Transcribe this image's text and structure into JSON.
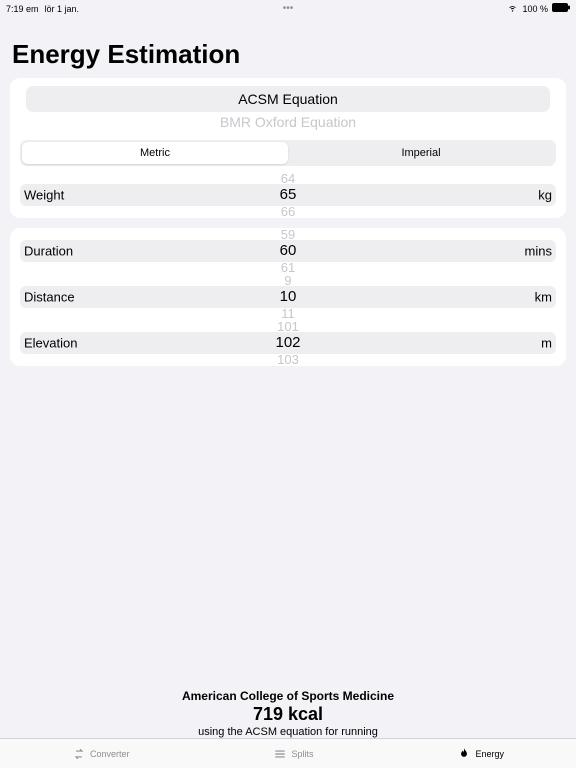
{
  "statusbar": {
    "time": "7:19 em",
    "date": "lör 1 jan.",
    "battery": "100 %"
  },
  "title": "Energy Estimation",
  "equation": {
    "selected": "ACSM Equation",
    "other": "BMR Oxford Equation"
  },
  "units": {
    "metric": "Metric",
    "imperial": "Imperial"
  },
  "weight": {
    "label": "Weight",
    "prev": "64",
    "value": "65",
    "next": "66",
    "unit": "kg"
  },
  "duration": {
    "label": "Duration",
    "prev": "59",
    "value": "60",
    "next": "61",
    "unit": "mins"
  },
  "distance": {
    "label": "Distance",
    "prev": "9",
    "value": "10",
    "next": "11",
    "unit": "km"
  },
  "elevation": {
    "label": "Elevation",
    "prev": "101",
    "value": "102",
    "next": "103",
    "unit": "m"
  },
  "result": {
    "heading": "American College of Sports Medicine",
    "kcal": "719 kcal",
    "sub": "using the ACSM equation for running"
  },
  "tabs": {
    "converter": "Converter",
    "splits": "Splits",
    "energy": "Energy"
  }
}
